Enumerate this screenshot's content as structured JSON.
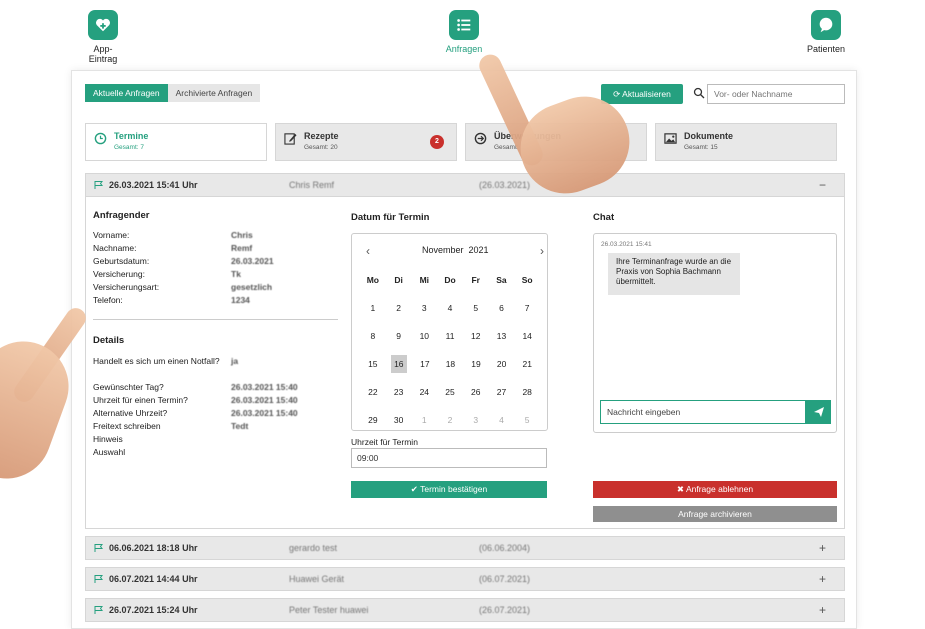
{
  "topnav": {
    "items": [
      {
        "label": "App-Eintrag",
        "icon": "heart-plus-icon"
      },
      {
        "label": "Anfragen",
        "icon": "list-icon",
        "active": true
      },
      {
        "label": "Patienten",
        "icon": "chat-bubble-icon"
      }
    ]
  },
  "toolbar": {
    "tabs": [
      "Aktuelle Anfragen",
      "Archivierte Anfragen"
    ],
    "refresh_label": "Aktualisieren",
    "search_placeholder": "Vor- oder Nachname"
  },
  "categories": [
    {
      "title": "Termine",
      "sub": "Gesamt: 7",
      "icon": "clock-icon",
      "active": true
    },
    {
      "title": "Rezepte",
      "sub": "Gesamt: 20",
      "icon": "edit-icon",
      "badge": "2"
    },
    {
      "title": "Überweisungen",
      "sub": "Gesamt: 1",
      "icon": "arrow-circle-icon"
    },
    {
      "title": "Dokumente",
      "sub": "Gesamt: 15",
      "icon": "image-icon"
    }
  ],
  "requests": [
    {
      "date": "26.03.2021 15:41 Uhr",
      "name": "Chris Remf",
      "dob": "(26.03.2021)",
      "toggle": "−",
      "expanded": true
    },
    {
      "date": "06.06.2021 18:18 Uhr",
      "name": "gerardo test",
      "dob": "(06.06.2004)",
      "toggle": "+"
    },
    {
      "date": "06.07.2021 14:44 Uhr",
      "name": "Huawei Gerät",
      "dob": "(06.07.2021)",
      "toggle": "+"
    },
    {
      "date": "26.07.2021 15:24 Uhr",
      "name": "Peter Tester huawei",
      "dob": "(26.07.2021)",
      "toggle": "+"
    }
  ],
  "detail": {
    "requester_title": "Anfragender",
    "requester_fields": [
      {
        "label": "Vorname:",
        "value": "Chris"
      },
      {
        "label": "Nachname:",
        "value": "Remf"
      },
      {
        "label": "Geburtsdatum:",
        "value": "26.03.2021"
      },
      {
        "label": "Versicherung:",
        "value": "Tk"
      },
      {
        "label": "Versicherungsart:",
        "value": "gesetzlich"
      },
      {
        "label": "Telefon:",
        "value": "1234"
      }
    ],
    "details_title": "Details",
    "details_fields": [
      {
        "label": "Handelt es sich um einen Notfall?",
        "value": "ja"
      },
      {
        "label": "Gewünschter Tag?",
        "value": "26.03.2021 15:40"
      },
      {
        "label": "Uhrzeit für einen Termin?",
        "value": "26.03.2021 15:40"
      },
      {
        "label": "Alternative Uhrzeit?",
        "value": "26.03.2021 15:40"
      },
      {
        "label": "Freitext schreiben",
        "value": "Tedt"
      },
      {
        "label": "Hinweis",
        "value": ""
      },
      {
        "label": "Auswahl",
        "value": ""
      }
    ]
  },
  "calendar": {
    "title": "Datum für Termin",
    "month": "November",
    "year": "2021",
    "weekdays": [
      "Mo",
      "Di",
      "Mi",
      "Do",
      "Fr",
      "Sa",
      "So"
    ],
    "weeks": [
      [
        "1",
        "2",
        "3",
        "4",
        "5",
        "6",
        "7"
      ],
      [
        "8",
        "9",
        "10",
        "11",
        "12",
        "13",
        "14"
      ],
      [
        "15",
        "16",
        "17",
        "18",
        "19",
        "20",
        "21"
      ],
      [
        "22",
        "23",
        "24",
        "25",
        "26",
        "27",
        "28"
      ],
      [
        "29",
        "30",
        "1",
        "2",
        "3",
        "4",
        "5"
      ]
    ],
    "selected": "16",
    "time_label": "Uhrzeit für Termin",
    "time_value": "09:00",
    "confirm_label": "Termin bestätigen"
  },
  "chat": {
    "title": "Chat",
    "timestamp": "26.03.2021 15:41",
    "message": "Ihre Terminanfrage wurde an die Praxis von Sophia Bachmann übermittelt.",
    "input_placeholder": "Nachricht eingeben"
  },
  "actions": {
    "reject_label": "Anfrage ablehnen",
    "archive_label": "Anfrage archivieren"
  },
  "colors": {
    "accent": "#25a07f",
    "danger": "#c9302c",
    "muted": "#8f8f8f"
  }
}
